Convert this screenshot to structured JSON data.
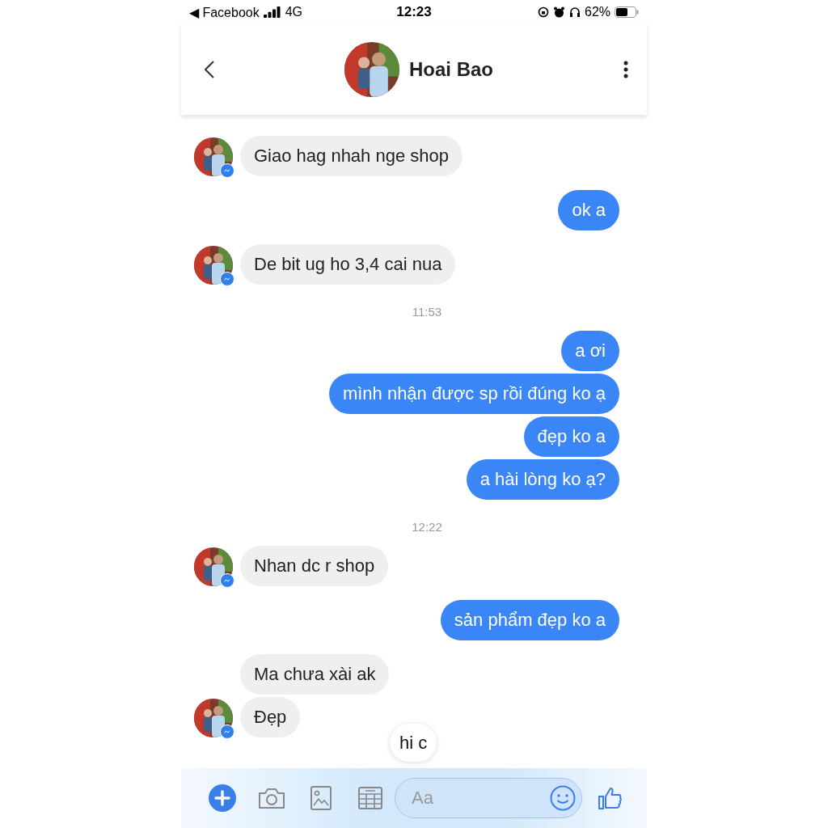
{
  "status_bar": {
    "back_app": "◀ Facebook",
    "network": "4G",
    "time": "12:23",
    "battery": "62%"
  },
  "header": {
    "name": "Hoai Bao"
  },
  "messages": [
    {
      "kind": "received",
      "text": "Giao hag nhah nge shop",
      "avatar": true
    },
    {
      "kind": "sent",
      "text": "ok a"
    },
    {
      "kind": "received",
      "text": "De bit ug ho 3,4 cai nua",
      "avatar": true
    },
    {
      "kind": "time",
      "text": "11:53"
    },
    {
      "kind": "sent",
      "text": "a ơi"
    },
    {
      "kind": "sent",
      "text": "mình nhận được sp rồi đúng ko ạ"
    },
    {
      "kind": "sent",
      "text": "đẹp ko a"
    },
    {
      "kind": "sent",
      "text": "a hài lòng ko ạ?"
    },
    {
      "kind": "time",
      "text": "12:22"
    },
    {
      "kind": "received",
      "text": "Nhan dc r shop",
      "avatar": true
    },
    {
      "kind": "sent",
      "text": "sản phẩm đẹp ko a"
    },
    {
      "kind": "received",
      "text": "Ma chưa  xài ak",
      "avatar": false
    },
    {
      "kind": "received",
      "text": "Đẹp",
      "avatar": true
    }
  ],
  "suggestion": "hi c",
  "composer": {
    "placeholder": "Aa"
  }
}
